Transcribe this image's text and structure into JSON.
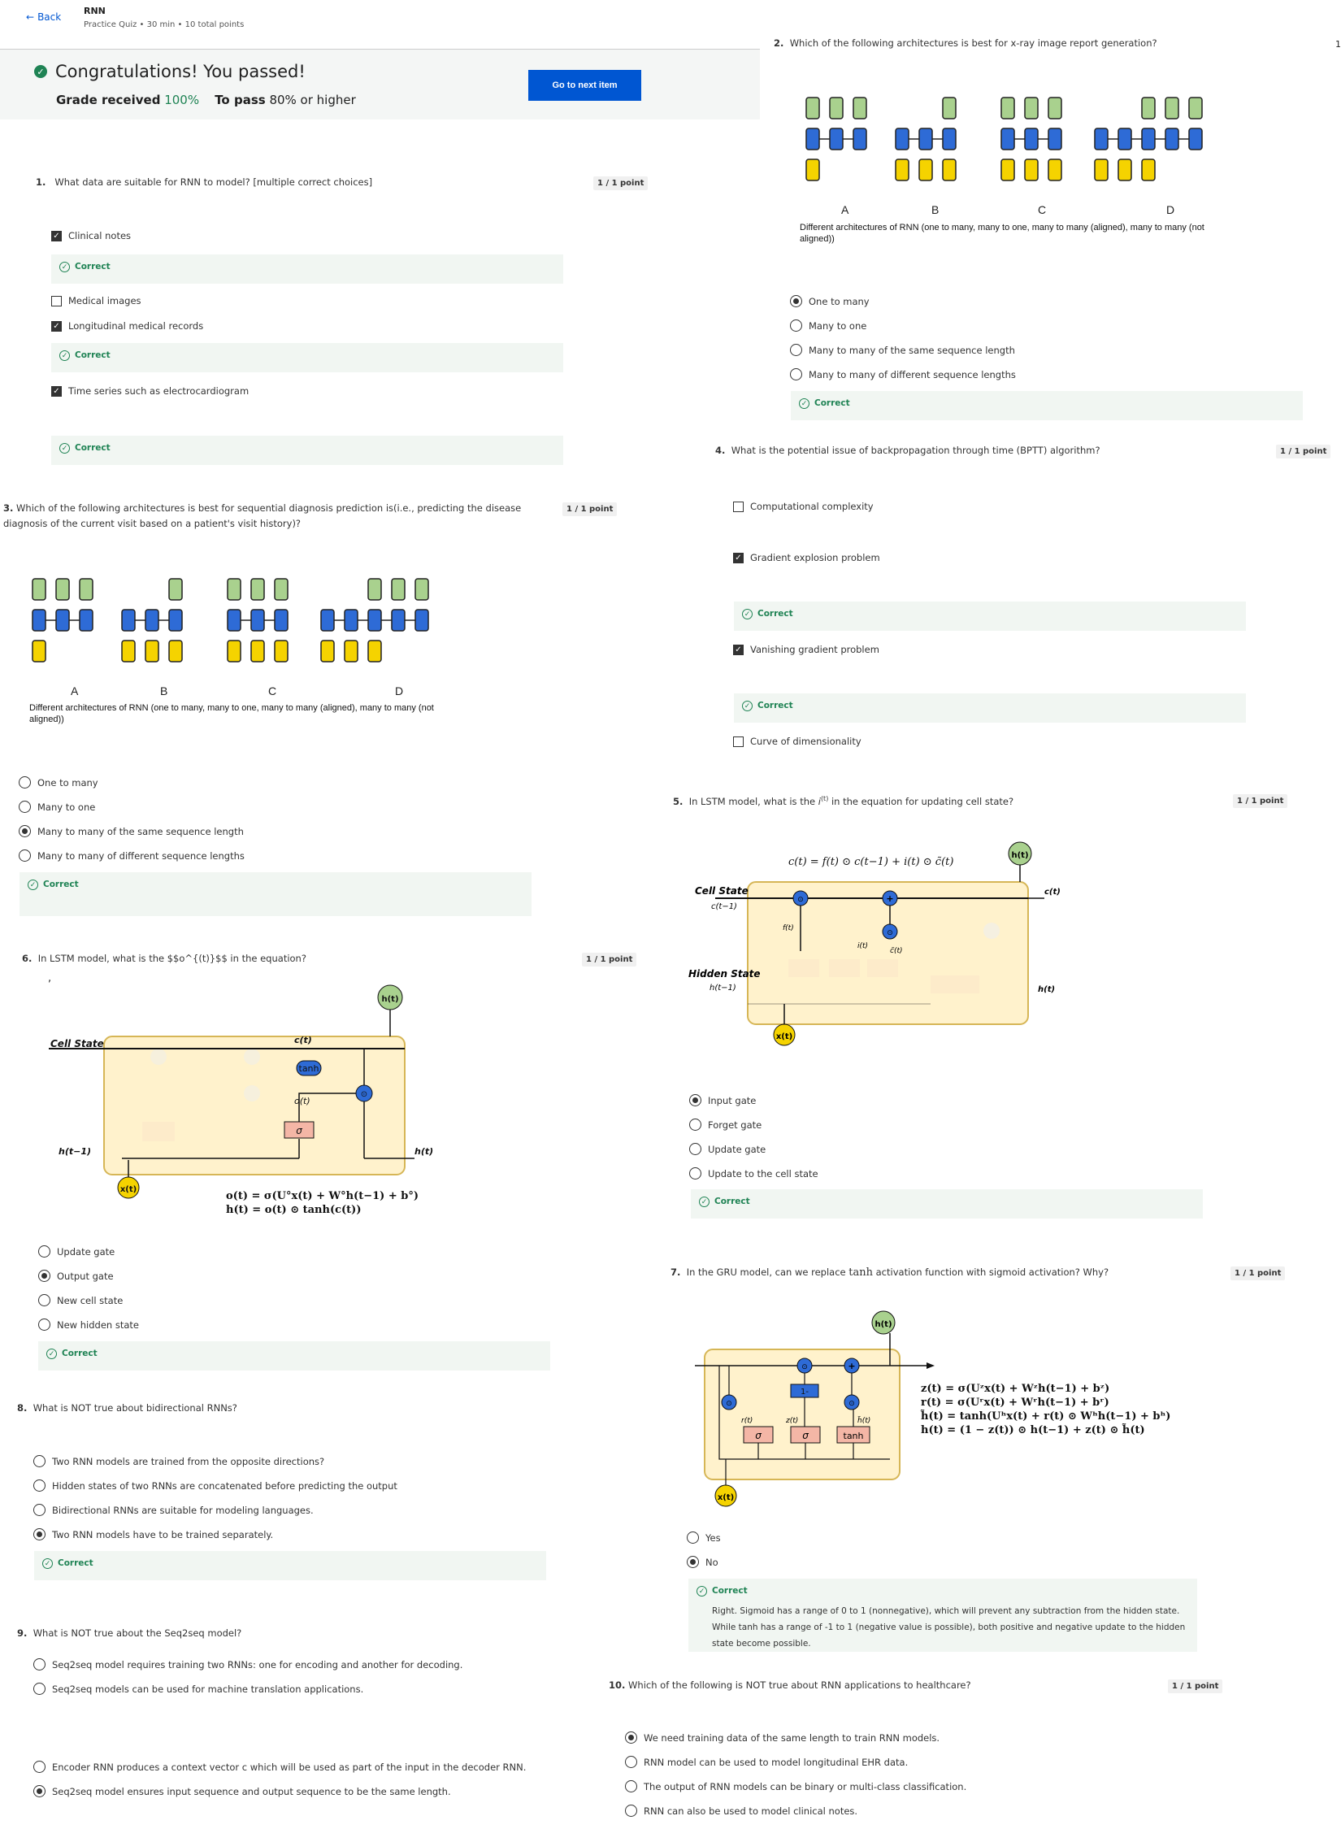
{
  "header": {
    "back_label": "Back",
    "title": "RNN",
    "subtitle": "Practice Quiz • 30 min • 10 total points"
  },
  "banner": {
    "title": "Congratulations! You passed!",
    "grade_label": "Grade received",
    "grade_value": "100%",
    "pass_label": "To pass",
    "pass_value": "80% or higher",
    "next_button": "Go to next item"
  },
  "colors": {
    "accent": "#0056d2",
    "correct": "#1f8354",
    "green_box": "#a9d18e",
    "blue_box": "#2e6bd6",
    "yellow_box": "#f5d300"
  },
  "feedback_label": "Correct",
  "figure": {
    "letters": [
      "A",
      "B",
      "C",
      "D"
    ],
    "caption": "Different architectures of RNN (one to many, many to one, many to many (aligned), many to many (not aligned))"
  },
  "q1": {
    "number": "1.",
    "text": "What data are suitable for RNN to model? [multiple correct choices]",
    "points": "1 / 1 point",
    "options": [
      "Clinical notes",
      "Medical images",
      "Longitudinal medical records",
      "Time series such as electrocardiogram"
    ]
  },
  "q2": {
    "number": "2.",
    "text": "Which of the following architectures is best for x-ray image report generation?",
    "options": [
      "One to many",
      "Many to one",
      "Many to many of the same sequence length",
      "Many to many of different sequence lengths"
    ]
  },
  "q3": {
    "number": "3.",
    "text": "Which of the following architectures is best for sequential diagnosis prediction is(i.e., predicting the disease diagnosis of the current visit based on a patient's visit history)?",
    "points": "1 / 1 point",
    "options": [
      "One to many",
      "Many to one",
      "Many to many of the same sequence length",
      "Many to many of different sequence lengths"
    ]
  },
  "q4": {
    "number": "4.",
    "text": "What is the potential issue of backpropagation through time (BPTT) algorithm?",
    "points": "1 / 1 point",
    "options": [
      "Computational complexity",
      "Gradient explosion problem",
      "Vanishing gradient problem",
      "Curve of dimensionality"
    ]
  },
  "q5": {
    "number": "5.",
    "text_before": "In LSTM model, what is the ",
    "symbol": "i",
    "symbol_sup": "(t)",
    "text_after": " in the equation for updating cell state?",
    "points": "1 / 1 point",
    "equation": "c(t) = f(t) ⊙ c(t−1) + i(t) ⊙ c̃(t)",
    "diagram": {
      "cell_state": "Cell State",
      "cell_prev": "c(t−1)",
      "hidden_state": "Hidden State",
      "hidden_prev": "h(t−1)",
      "f": "f(t)",
      "i": "i(t)",
      "c_tilde": "c̃(t)",
      "c_out": "c(t)",
      "h_out": "h(t)",
      "x": "x(t)",
      "h_top": "h(t)"
    },
    "options": [
      "Input gate",
      "Forget gate",
      "Update gate",
      "Update to the cell state"
    ]
  },
  "q6": {
    "number": "6.",
    "text": "In LSTM model, what is the $$o^{(t)}$$ in the equation?",
    "stray": ",",
    "points": "1 / 1 point",
    "diagram": {
      "cell_state": "Cell State",
      "h_prev": "h(t−1)",
      "o": "o(t)",
      "sigma": "σ",
      "tanh": "tanh",
      "c_out": "c(t)",
      "h_out": "h(t)",
      "h_top": "h(t)",
      "x": "x(t)"
    },
    "equations": [
      "o(t) = σ(U°x(t) + W°h(t−1) + b°)",
      "h(t) = o(t) ⊙ tanh(c(t))"
    ],
    "options": [
      "Update gate",
      "Output gate",
      "New cell state",
      "New hidden state"
    ]
  },
  "q7": {
    "number": "7.",
    "text_before": "In the GRU model, can we replace ",
    "keyword": "tanh",
    "text_after": " activation function with sigmoid activation? Why?",
    "points": "1 / 1 point",
    "diagram": {
      "r": "r(t)",
      "z": "z(t)",
      "h_tilde": "h̃(t)",
      "sigma": "σ",
      "tanh": "tanh",
      "one_minus": "1-",
      "x": "x(t)",
      "h_top": "h(t)"
    },
    "equations": [
      "z(t) = σ(Uᶻx(t) + Wᶻh(t−1) + bᶻ)",
      "r(t) = σ(Uʳx(t) + Wʳh(t−1) + bʳ)",
      "h̃(t) = tanh(Uʰx(t) + r(t) ⊙ Wʰh(t−1) + bʰ)",
      "h(t) = (1 − z(t)) ⊙ h(t−1) + z(t) ⊙ h̃(t)"
    ],
    "options": [
      "Yes",
      "No"
    ],
    "explanation": "Right. Sigmoid has a range of 0 to 1 (nonnegative), which will prevent any subtraction from the hidden state. While tanh has a range of -1 to 1 (negative value is possible), both positive and negative update to the hidden state become possible."
  },
  "q8": {
    "number": "8.",
    "text": "What is NOT true about bidirectional RNNs?",
    "options": [
      "Two RNN models are trained from the opposite directions?",
      "Hidden states of two RNNs are concatenated before predicting the output",
      "Bidirectional RNNs are suitable for modeling languages.",
      "Two RNN models have to be trained separately."
    ]
  },
  "q9": {
    "number": "9.",
    "text": "What is NOT true about the Seq2seq model?",
    "options": [
      "Seq2seq model requires training two RNNs: one for encoding and another for decoding.",
      "Seq2seq models can be used for machine translation applications.",
      "Encoder RNN produces a context vector c which will be used as part of the input in the decoder RNN.",
      "Seq2seq model ensures input sequence and output sequence to be the same length."
    ]
  },
  "q10": {
    "number": "10.",
    "text": "Which of the following is NOT true about RNN applications to healthcare?",
    "points": "1 / 1 point",
    "options": [
      "We need training data of the same length to train RNN models.",
      "RNN model can be used to model longitudinal EHR data.",
      "The output of RNN models can be binary or multi-class classification.",
      "RNN can also be used to model clinical notes."
    ]
  },
  "edge_marker": "1"
}
